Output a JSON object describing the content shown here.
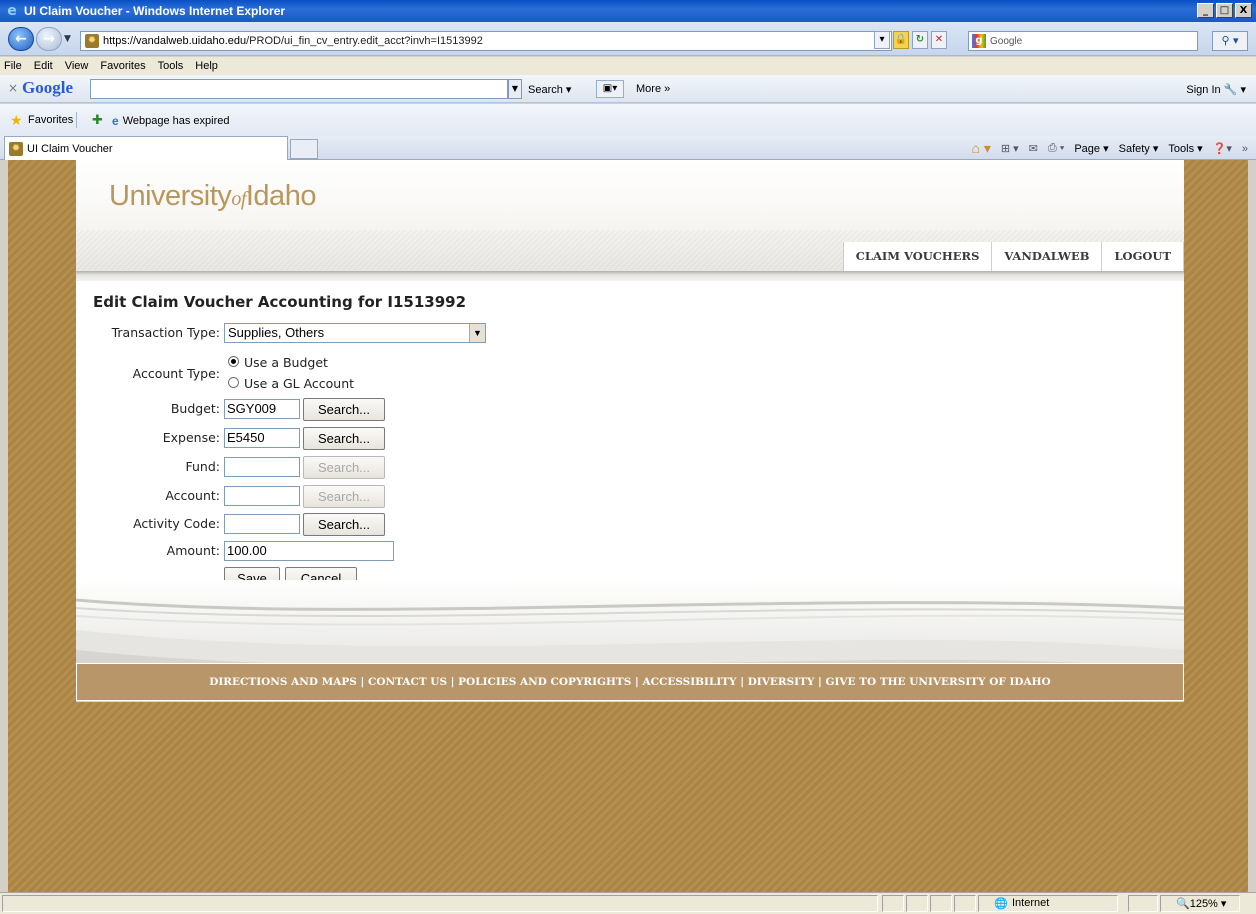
{
  "window": {
    "title": "UI Claim Voucher - Windows Internet Explorer",
    "buttons": {
      "minimize": "_",
      "maximize": "□",
      "close": "X"
    }
  },
  "address": {
    "url_host": "https://vandalweb.uidaho.edu",
    "url_path": "/PROD/ui_fin_cv_entry.edit_acct?invh=I1513992",
    "search_placeholder": "Google"
  },
  "menu": [
    "File",
    "Edit",
    "View",
    "Favorites",
    "Tools",
    "Help"
  ],
  "google_toolbar": {
    "logo": "Google",
    "search_label": "Search",
    "more_label": "More »",
    "sign_in": "Sign In"
  },
  "favorites_bar": {
    "favorites_label": "Favorites",
    "item": "Webpage has expired"
  },
  "tabs": [
    {
      "label": "UI Claim Voucher"
    }
  ],
  "command_bar": {
    "page": "Page",
    "safety": "Safety",
    "tools": "Tools"
  },
  "site": {
    "logo_pre": "University",
    "logo_of": "of",
    "logo_post": "Idaho",
    "nav": [
      "CLAIM VOUCHERS",
      "VANDALWEB",
      "LOGOUT"
    ],
    "footer": "DIRECTIONS AND MAPS | CONTACT US | POLICIES AND COPYRIGHTS | ACCESSIBILITY | DIVERSITY | GIVE TO THE UNIVERSITY OF IDAHO"
  },
  "form": {
    "title": "Edit Claim Voucher Accounting for I1513992",
    "transaction_type_label": "Transaction Type:",
    "transaction_type_value": "Supplies, Others",
    "account_type_label": "Account Type:",
    "account_type_options": [
      "Use a Budget",
      "Use a GL Account"
    ],
    "account_type_selected": "Use a Budget",
    "search_label": "Search...",
    "fields": [
      {
        "label": "Budget:",
        "value": "SGY009"
      },
      {
        "label": "Expense:",
        "value": "E5450"
      },
      {
        "label": "Fund:",
        "value": ""
      },
      {
        "label": "Account:",
        "value": ""
      },
      {
        "label": "Activity Code:",
        "value": ""
      }
    ],
    "amount_label": "Amount:",
    "amount_value": "100.00",
    "save_label": "Save",
    "cancel_label": "Cancel"
  },
  "status_bar": {
    "zone": "Internet",
    "zoom": "125%"
  },
  "colors": {
    "brand_gold": "#b9975b",
    "footer_bg": "#b8966a",
    "background_pattern": "#b48f4e"
  }
}
